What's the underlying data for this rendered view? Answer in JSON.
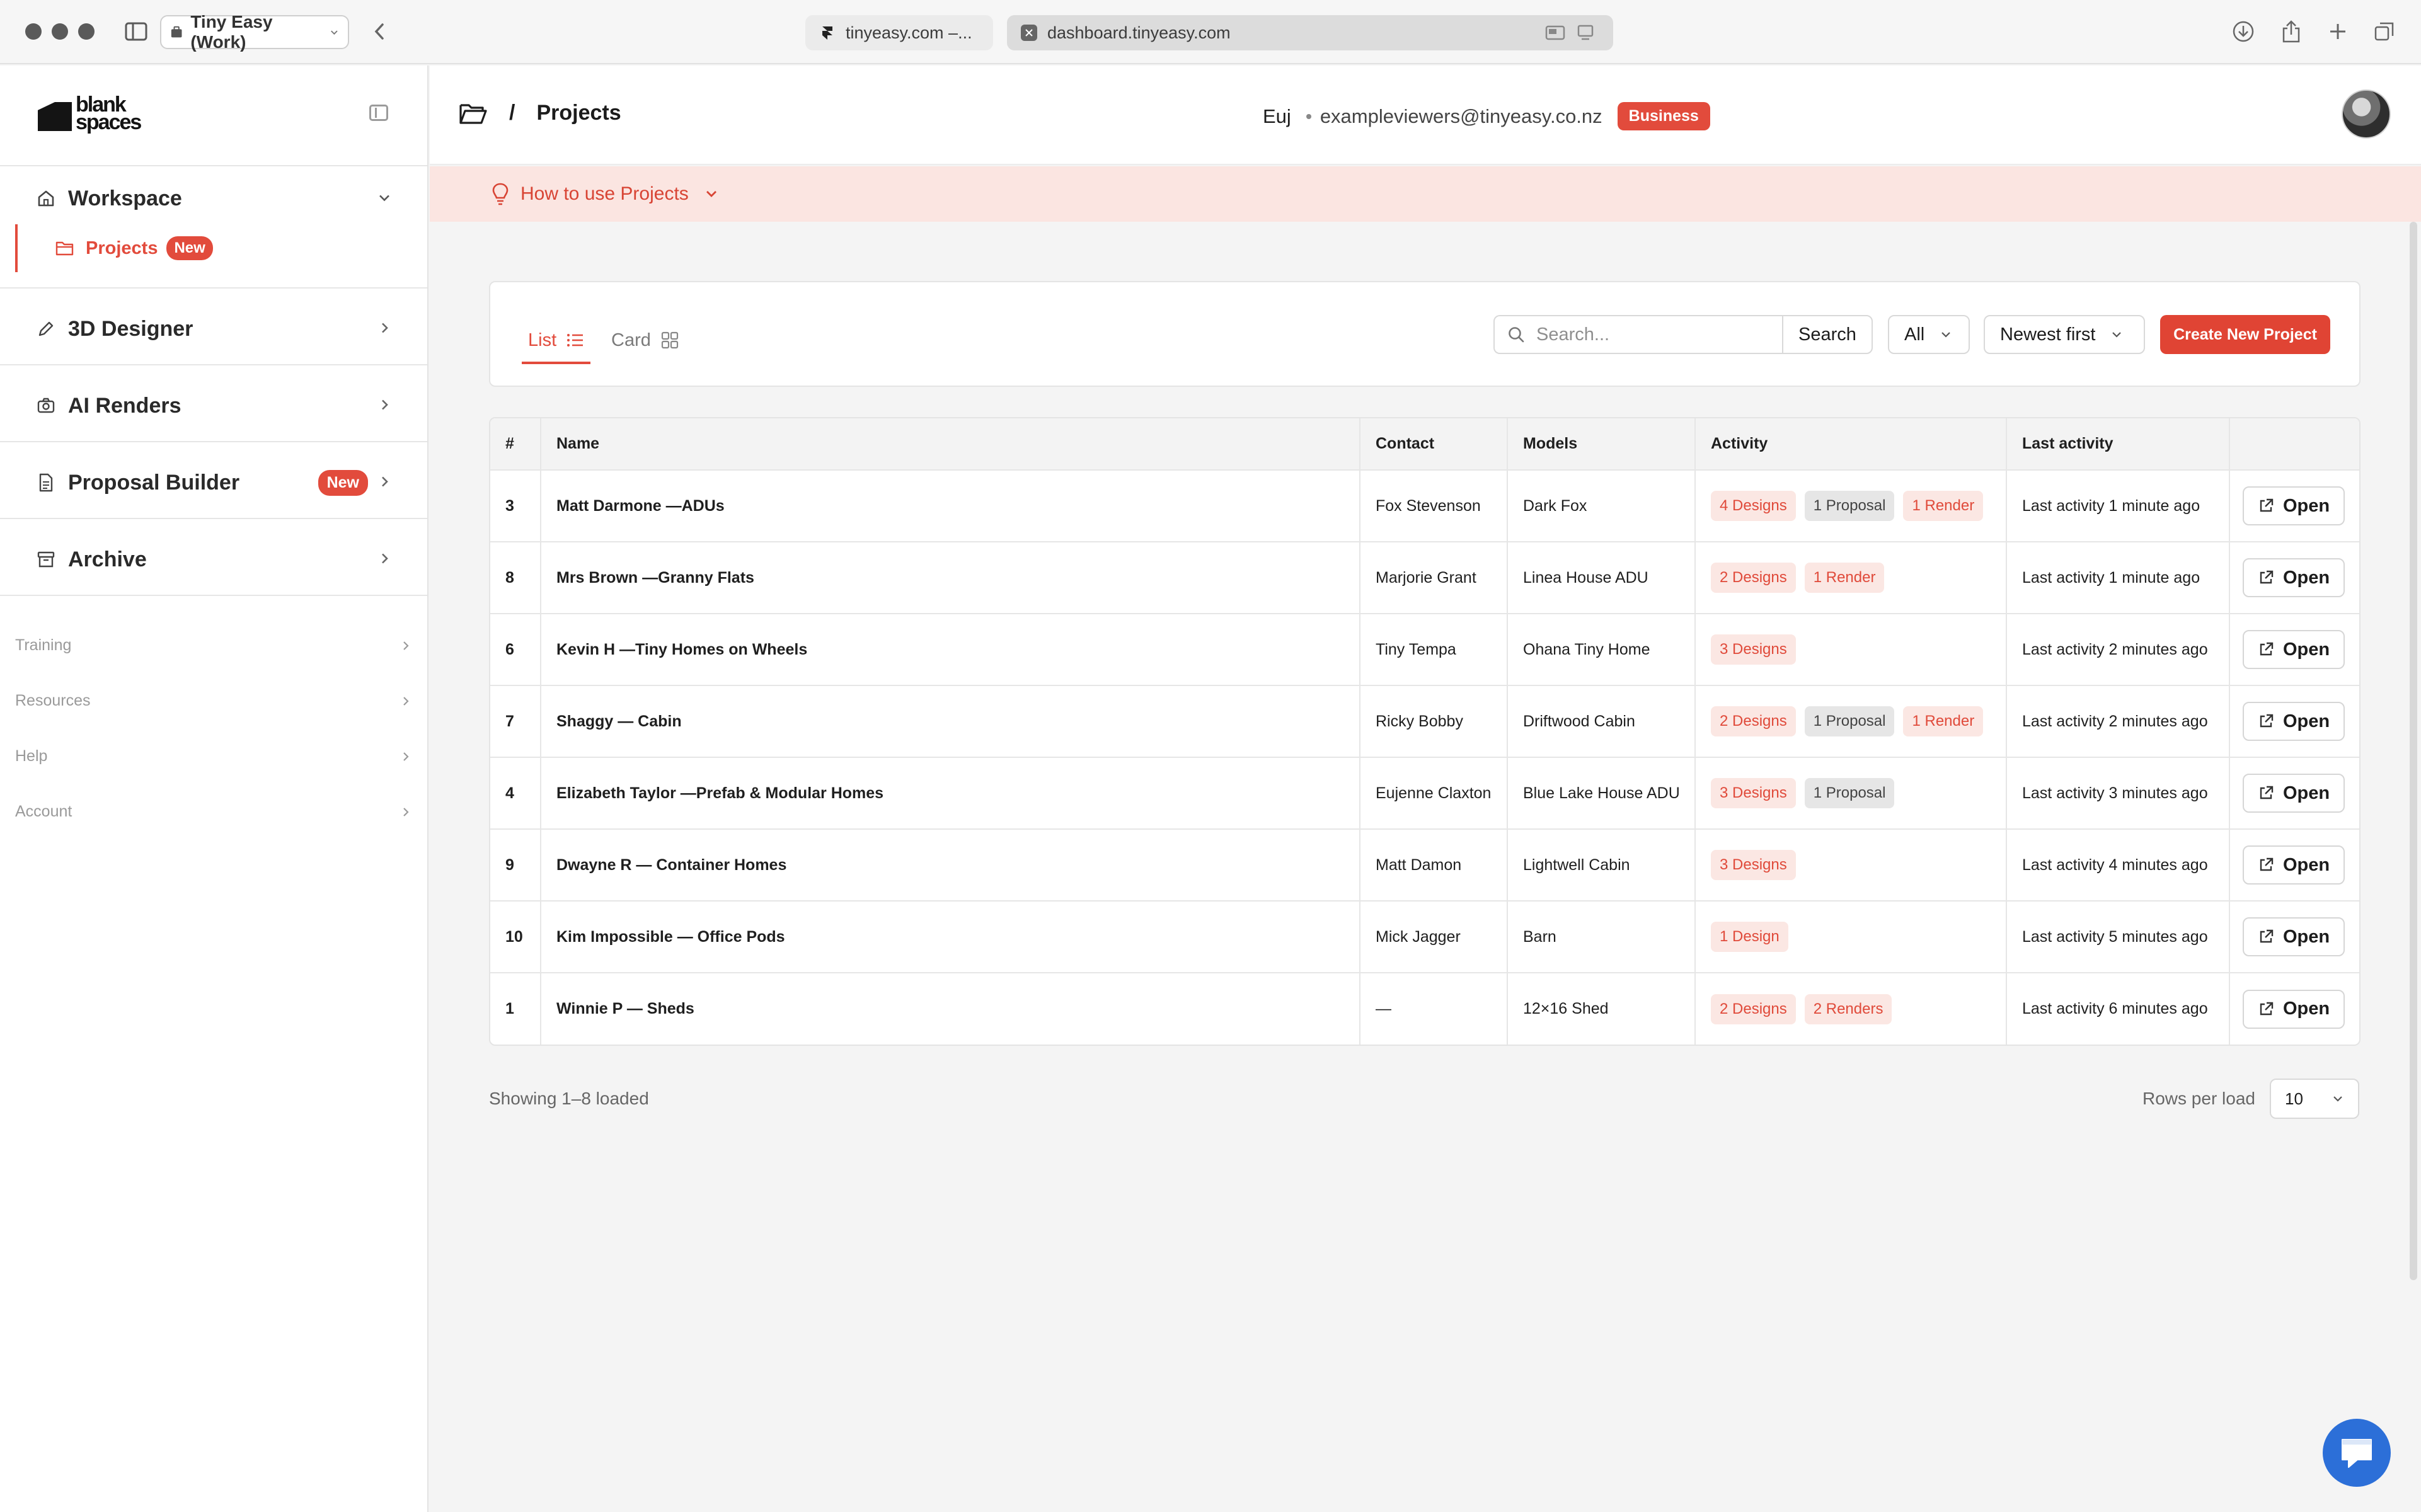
{
  "browser": {
    "profile": "Tiny Easy (Work)",
    "tabs": [
      {
        "title": "tinyeasy.com –..."
      },
      {
        "title": "dashboard.tinyeasy.com"
      }
    ]
  },
  "sidebar": {
    "logo_line1": "blank",
    "logo_line2": "spaces",
    "workspace": {
      "label": "Workspace",
      "sub": {
        "label": "Projects",
        "badge": "New"
      }
    },
    "items": [
      {
        "label": "3D Designer"
      },
      {
        "label": "AI Renders"
      },
      {
        "label": "Proposal Builder",
        "badge": "New"
      },
      {
        "label": "Archive"
      }
    ],
    "sections": [
      "Training",
      "Resources",
      "Help",
      "Account"
    ]
  },
  "header": {
    "breadcrumb_sep": "/",
    "title": "Projects",
    "user_name": "Euj",
    "user_email": "exampleviewers@tinyeasy.co.nz",
    "plan": "Business"
  },
  "banner": {
    "text": "How to use Projects"
  },
  "toolbar": {
    "view_list": "List",
    "view_card": "Card",
    "search_placeholder": "Search...",
    "search_button": "Search",
    "filter": "All",
    "sort": "Newest first",
    "create_button": "Create New Project"
  },
  "table": {
    "columns": [
      "#",
      "Name",
      "Contact",
      "Models",
      "Activity",
      "Last activity",
      ""
    ],
    "open_label": "Open",
    "rows": [
      {
        "num": "3",
        "name": "Matt Darmone —ADUs",
        "contact": "Fox Stevenson",
        "model": "Dark Fox",
        "chips": [
          {
            "t": "4 Designs",
            "c": "red"
          },
          {
            "t": "1 Proposal",
            "c": "gray"
          },
          {
            "t": "1 Render",
            "c": "red"
          }
        ],
        "last": "Last activity 1 minute ago"
      },
      {
        "num": "8",
        "name": "Mrs Brown —Granny Flats",
        "contact": "Marjorie Grant",
        "model": "Linea House ADU",
        "chips": [
          {
            "t": "2 Designs",
            "c": "red"
          },
          {
            "t": "1 Render",
            "c": "red"
          }
        ],
        "last": "Last activity 1 minute ago"
      },
      {
        "num": "6",
        "name": "Kevin H —Tiny Homes on Wheels",
        "contact": "Tiny Tempa",
        "model": "Ohana Tiny Home",
        "chips": [
          {
            "t": "3 Designs",
            "c": "red"
          }
        ],
        "last": "Last activity 2 minutes ago"
      },
      {
        "num": "7",
        "name": "Shaggy — Cabin",
        "contact": "Ricky Bobby",
        "model": "Driftwood Cabin",
        "chips": [
          {
            "t": "2 Designs",
            "c": "red"
          },
          {
            "t": "1 Proposal",
            "c": "gray"
          },
          {
            "t": "1 Render",
            "c": "red"
          }
        ],
        "last": "Last activity 2 minutes ago"
      },
      {
        "num": "4",
        "name": "Elizabeth Taylor —Prefab & Modular Homes",
        "contact": "Eujenne Claxton",
        "model": "Blue Lake House ADU",
        "chips": [
          {
            "t": "3 Designs",
            "c": "red"
          },
          {
            "t": "1 Proposal",
            "c": "gray"
          }
        ],
        "last": "Last activity 3 minutes ago"
      },
      {
        "num": "9",
        "name": "Dwayne R — Container Homes",
        "contact": "Matt Damon",
        "model": "Lightwell Cabin",
        "chips": [
          {
            "t": "3 Designs",
            "c": "red"
          }
        ],
        "last": "Last activity 4 minutes ago"
      },
      {
        "num": "10",
        "name": "Kim Impossible — Office Pods",
        "contact": "Mick Jagger",
        "model": "Barn",
        "chips": [
          {
            "t": "1 Design",
            "c": "red"
          }
        ],
        "last": "Last activity 5 minutes ago"
      },
      {
        "num": "1",
        "name": "Winnie P — Sheds",
        "contact": "—",
        "model": "12×16 Shed",
        "chips": [
          {
            "t": "2 Designs",
            "c": "red"
          },
          {
            "t": "2 Renders",
            "c": "red"
          }
        ],
        "last": "Last activity 6 minutes ago"
      }
    ]
  },
  "footer": {
    "showing": "Showing 1–8 loaded",
    "rows_label": "Rows per load",
    "rows_value": "10"
  },
  "colors": {
    "accent": "#e24b3c",
    "banner_bg": "#fbe5e1",
    "chat": "#2c6fd8"
  },
  "icons": [
    "sidebar-icon",
    "back-icon",
    "home-icon",
    "folder-icon",
    "pencil-icon",
    "camera-icon",
    "document-icon",
    "archive-icon",
    "lightbulb-icon",
    "search-icon",
    "list-icon",
    "grid-icon",
    "external-link-icon",
    "download-icon",
    "share-icon",
    "plus-icon",
    "tabs-icon",
    "chat-icon"
  ]
}
